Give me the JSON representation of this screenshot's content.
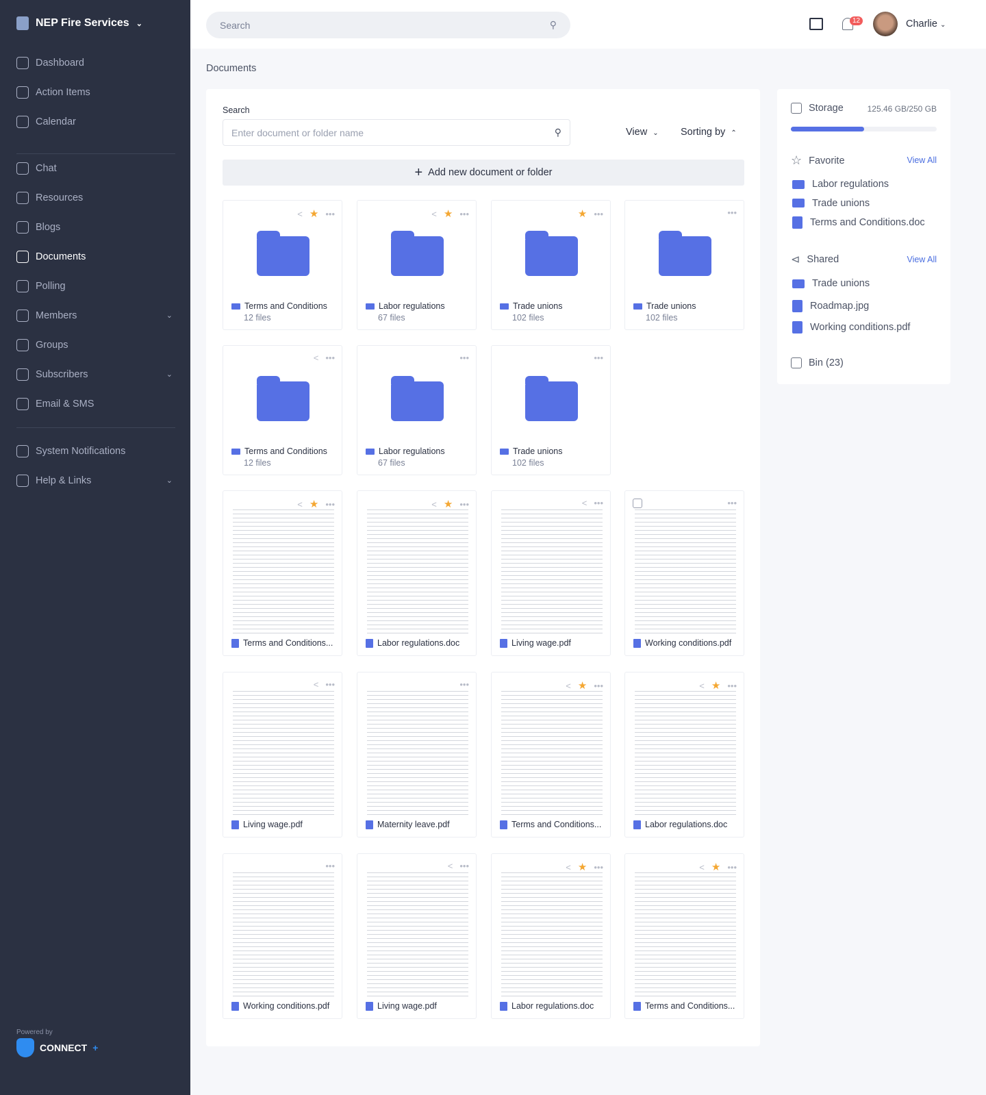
{
  "sidebar": {
    "brand": "NEP Fire Services",
    "items": [
      {
        "label": "Dashboard",
        "icon": "home-icon"
      },
      {
        "label": "Action Items",
        "icon": "command-icon"
      },
      {
        "label": "Calendar",
        "icon": "calendar-icon"
      }
    ],
    "items2": [
      {
        "label": "Chat",
        "icon": "chat-icon"
      },
      {
        "label": "Resources",
        "icon": "folder-icon"
      },
      {
        "label": "Blogs",
        "icon": "blog-icon"
      },
      {
        "label": "Documents",
        "icon": "document-icon",
        "active": true
      },
      {
        "label": "Polling",
        "icon": "poll-icon"
      },
      {
        "label": "Members",
        "icon": "user-icon",
        "chevron": true
      },
      {
        "label": "Groups",
        "icon": "grid-icon"
      },
      {
        "label": "Subscribers",
        "icon": "heart-icon",
        "chevron": true
      },
      {
        "label": "Email & SMS",
        "icon": "mail-icon"
      }
    ],
    "items3": [
      {
        "label": "System Notifications",
        "icon": "bell-icon"
      },
      {
        "label": "Help & Links",
        "icon": "shield-icon",
        "chevron": true
      }
    ],
    "powered_by": "Powered by",
    "powered_brand": "CONNECT"
  },
  "header": {
    "search_placeholder": "Search",
    "notifications": "12",
    "user": "Charlie"
  },
  "breadcrumb": "Documents",
  "main": {
    "search_label": "Search",
    "search_placeholder": "Enter document or folder name",
    "view": "View",
    "sorting": "Sorting by",
    "add": "Add new document or folder",
    "folders": [
      {
        "name": "Terms and Conditions",
        "count": "12 files",
        "share": true,
        "star": true
      },
      {
        "name": "Labor regulations",
        "count": "67 files",
        "share": true,
        "star": true
      },
      {
        "name": "Trade unions",
        "count": "102 files",
        "share": false,
        "star": true
      },
      {
        "name": "Trade unions",
        "count": "102 files",
        "share": false,
        "star": false
      },
      {
        "name": "Terms and Conditions",
        "count": "12 files",
        "share": true,
        "star": false
      },
      {
        "name": "Labor regulations",
        "count": "67 files",
        "share": false,
        "star": false
      },
      {
        "name": "Trade unions",
        "count": "102 files",
        "share": false,
        "star": false
      }
    ],
    "documents": [
      {
        "name": "Terms and Conditions...",
        "share": true,
        "star": true
      },
      {
        "name": "Labor regulations.doc",
        "share": true,
        "star": true
      },
      {
        "name": "Living wage.pdf",
        "share": true,
        "star": false
      },
      {
        "name": "Working conditions.pdf",
        "share": false,
        "star": false,
        "checkbox": true
      },
      {
        "name": "Living wage.pdf",
        "share": true,
        "star": false
      },
      {
        "name": "Maternity leave.pdf",
        "share": false,
        "star": false
      },
      {
        "name": "Terms and Conditions...",
        "share": true,
        "star": true
      },
      {
        "name": "Labor regulations.doc",
        "share": true,
        "star": true
      },
      {
        "name": "Working conditions.pdf",
        "share": false,
        "star": false
      },
      {
        "name": "Living wage.pdf",
        "share": true,
        "star": false
      },
      {
        "name": "Labor regulations.doc",
        "share": true,
        "star": true
      },
      {
        "name": "Terms and Conditions...",
        "share": true,
        "star": true
      }
    ]
  },
  "side": {
    "storage_label": "Storage",
    "storage_value": "125.46 GB/250 GB",
    "storage_percent": 50.2,
    "favorite_label": "Favorite",
    "view_all": "View All",
    "favorites": [
      {
        "name": "Labor regulations",
        "type": "folder"
      },
      {
        "name": "Trade unions",
        "type": "folder"
      },
      {
        "name": "Terms and Conditions.doc",
        "type": "doc"
      }
    ],
    "shared_label": "Shared",
    "shared": [
      {
        "name": "Trade unions",
        "type": "folder"
      },
      {
        "name": "Roadmap.jpg",
        "type": "doc"
      },
      {
        "name": "Working conditions.pdf",
        "type": "pdf"
      }
    ],
    "bin": "Bin (23)"
  },
  "colors": {
    "sidebar": "#2b3142",
    "accent": "#5670e4",
    "star": "#f4a732",
    "badge": "#f25c5c"
  }
}
